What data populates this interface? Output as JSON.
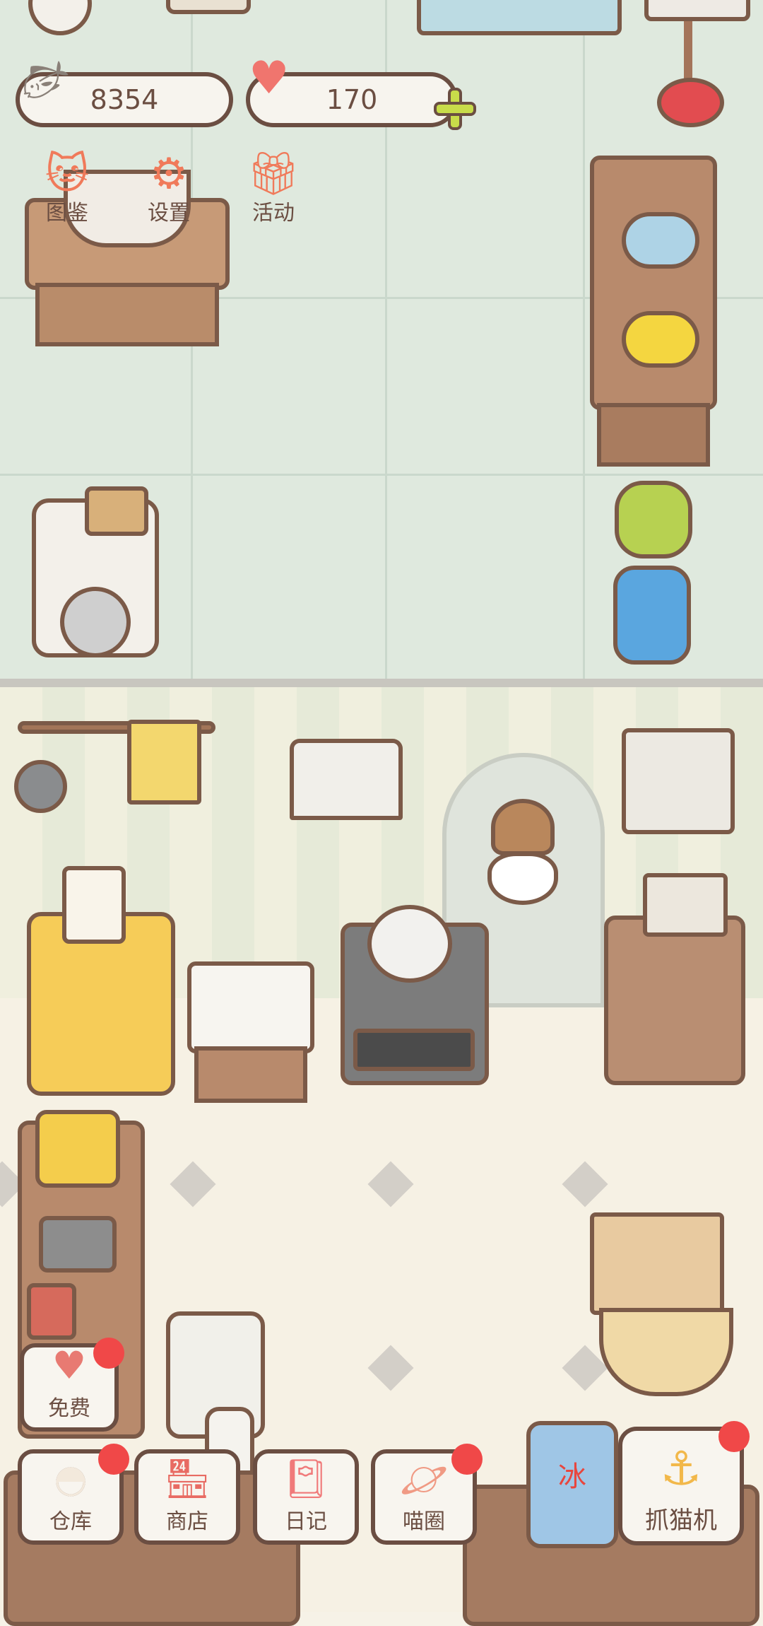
{
  "currency": {
    "fish_count": "8354",
    "heart_count": "170",
    "add_icon": "plus-icon"
  },
  "top_menu": [
    {
      "label": "图鉴",
      "icon": "cat-face-icon"
    },
    {
      "label": "设置",
      "icon": "gear-icon"
    },
    {
      "label": "活动",
      "icon": "gift-icon"
    }
  ],
  "free_button": {
    "label": "免费",
    "icon": "heart-icon"
  },
  "dock": [
    {
      "label": "仓库",
      "icon": "rice-bowl-icon"
    },
    {
      "label": "商店",
      "icon": "shop-icon"
    },
    {
      "label": "日记",
      "icon": "diary-icon"
    },
    {
      "label": "喵圈",
      "icon": "planet-cat-icon"
    }
  ],
  "claw_machine": {
    "label": "抓猫机",
    "icon": "claw-icon"
  },
  "ice_label": "冰",
  "colors": {
    "outline": "#6b4e42",
    "badge": "#f04848",
    "accent": "#f07a5a",
    "plus": "#c8dc4a"
  }
}
